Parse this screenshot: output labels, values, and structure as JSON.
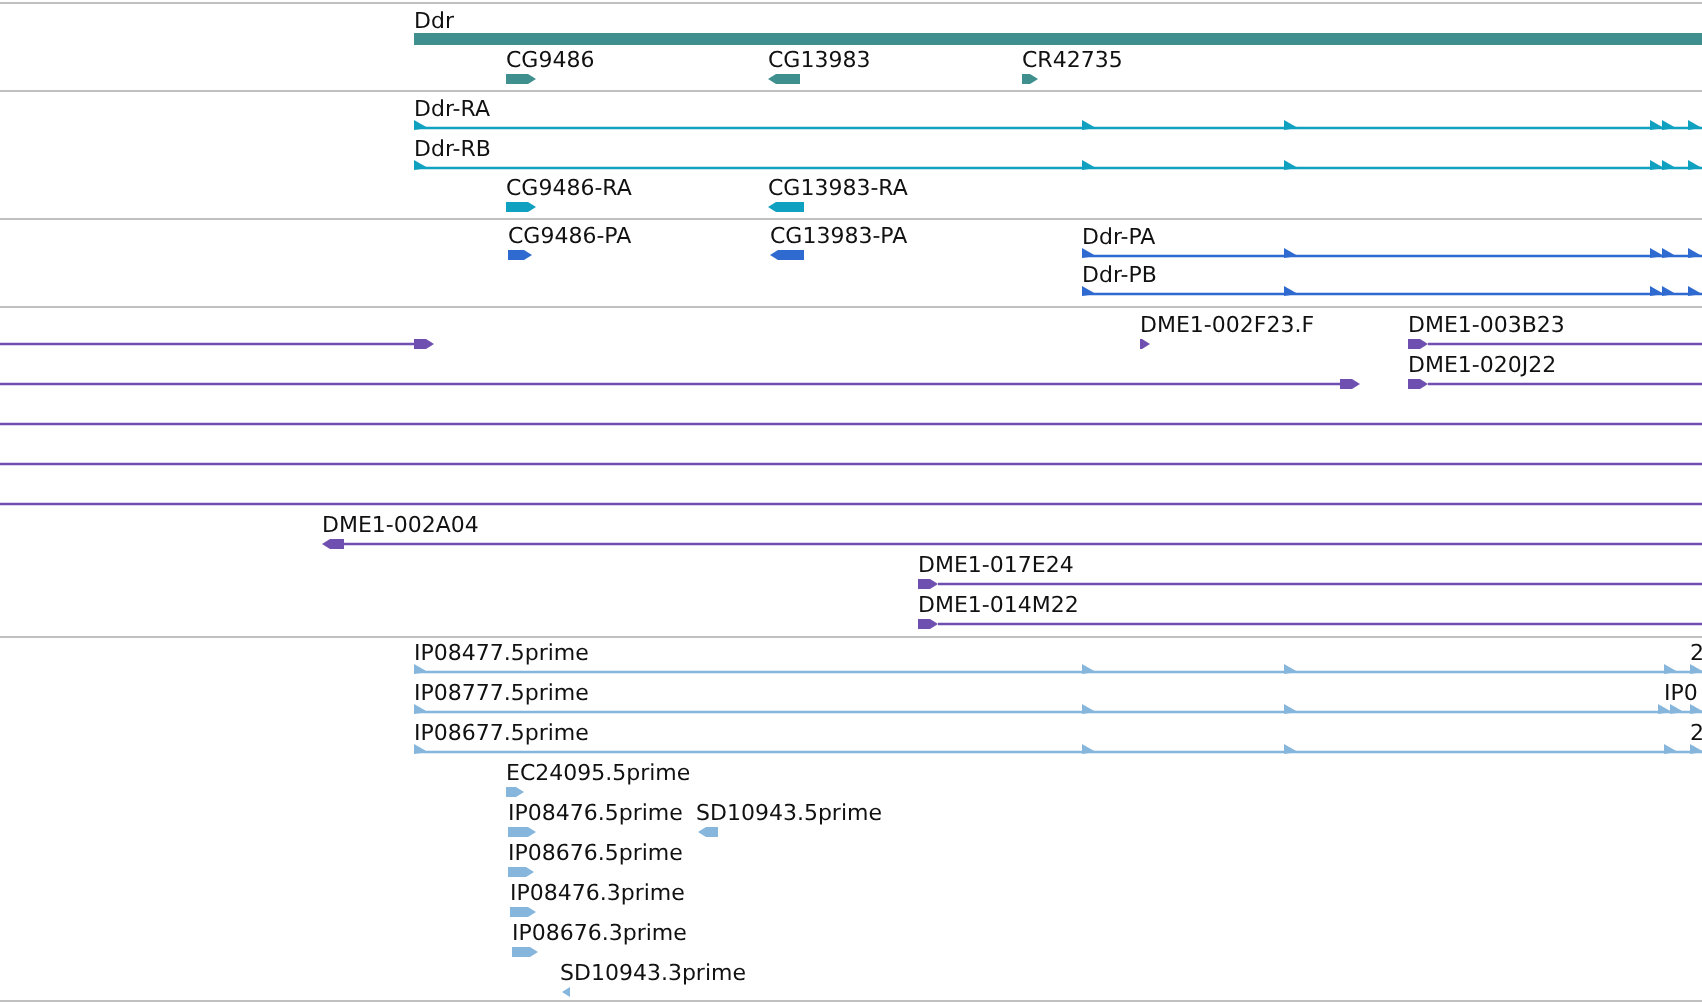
{
  "tracks": [
    {
      "color": "#3f8f8f",
      "features": [
        {
          "kind": "gene",
          "label": "Ddr"
        },
        {
          "kind": "exon",
          "label": "CG9486",
          "reverse": false
        },
        {
          "kind": "exon",
          "label": "CG13983",
          "reverse": true
        },
        {
          "kind": "exon",
          "label": "CR42735",
          "reverse": false
        }
      ]
    },
    {
      "color": "#10a0c0",
      "features": [
        {
          "kind": "transcript",
          "label": "Ddr-RA",
          "reverse": false
        },
        {
          "kind": "transcript",
          "label": "Ddr-RB",
          "reverse": false
        },
        {
          "kind": "exon",
          "label": "CG9486-RA",
          "reverse": false
        },
        {
          "kind": "exon",
          "label": "CG13983-RA",
          "reverse": true
        }
      ]
    },
    {
      "color": "#2f6ad0",
      "features": [
        {
          "kind": "exon",
          "label": "CG9486-PA",
          "reverse": false
        },
        {
          "kind": "exon",
          "label": "CG13983-PA",
          "reverse": true
        },
        {
          "kind": "transcript",
          "label": "Ddr-PA",
          "reverse": false
        },
        {
          "kind": "transcript",
          "label": "Ddr-PB",
          "reverse": false
        }
      ]
    },
    {
      "color": "#6f4fb0",
      "features": [
        {
          "kind": "transcript",
          "reverse": false
        },
        {
          "kind": "exon",
          "label": "DME1-002F23.F",
          "reverse": false
        },
        {
          "kind": "transcript",
          "label": "DME1-003B23",
          "reverse": false
        },
        {
          "kind": "transcript",
          "reverse": false
        },
        {
          "kind": "transcript",
          "label": "DME1-020J22",
          "reverse": false
        },
        {
          "kind": "transcript"
        },
        {
          "kind": "transcript"
        },
        {
          "kind": "transcript"
        },
        {
          "kind": "transcript",
          "label": "DME1-002A04",
          "reverse": true
        },
        {
          "kind": "transcript",
          "label": "DME1-017E24",
          "reverse": false
        },
        {
          "kind": "transcript",
          "label": "DME1-014M22",
          "reverse": false
        }
      ]
    },
    {
      "color": "#86b6dc",
      "features": [
        {
          "kind": "transcript",
          "label": "IP08477.5prime",
          "reverse": false
        },
        {
          "kind": "exon",
          "label": "2",
          "reverse": false
        },
        {
          "kind": "transcript",
          "label": "IP08777.5prime",
          "reverse": false
        },
        {
          "kind": "exon",
          "label": "IP0",
          "reverse": false
        },
        {
          "kind": "transcript",
          "label": "IP08677.5prime",
          "reverse": false
        },
        {
          "kind": "exon",
          "label": "2",
          "reverse": false
        },
        {
          "kind": "exon",
          "label": "EC24095.5prime",
          "reverse": false
        },
        {
          "kind": "exon",
          "label": "IP08476.5prime",
          "reverse": false
        },
        {
          "kind": "exon",
          "label": "SD10943.5prime",
          "reverse": true
        },
        {
          "kind": "exon",
          "label": "IP08676.5prime",
          "reverse": false
        },
        {
          "kind": "exon",
          "label": "IP08476.3prime",
          "reverse": false
        },
        {
          "kind": "exon",
          "label": "IP08676.3prime",
          "reverse": false
        },
        {
          "kind": "exon",
          "label": "SD10943.3prime",
          "reverse": true
        }
      ]
    }
  ]
}
